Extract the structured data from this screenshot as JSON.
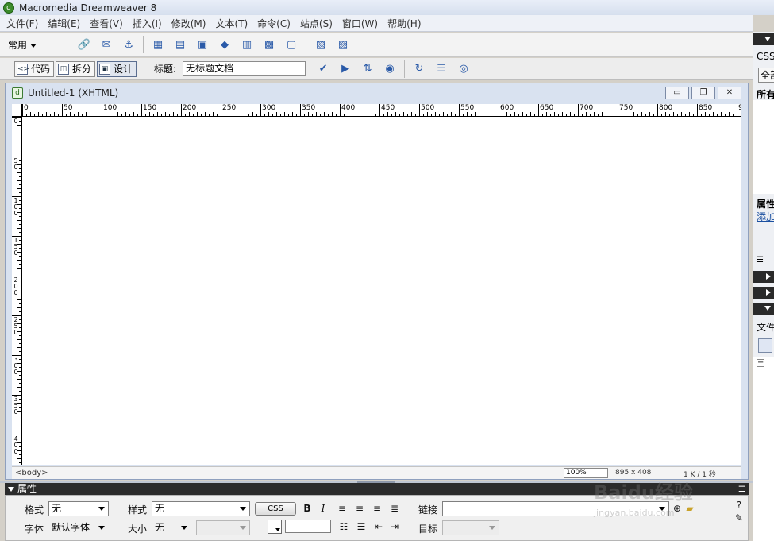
{
  "titlebar": {
    "title": "Macromedia Dreamweaver 8"
  },
  "menubar": {
    "items": [
      "文件(F)",
      "编辑(E)",
      "查看(V)",
      "插入(I)",
      "修改(M)",
      "文本(T)",
      "命令(C)",
      "站点(S)",
      "窗口(W)",
      "帮助(H)"
    ]
  },
  "insertbar": {
    "category": "常用",
    "icons": [
      "hyperlink-icon",
      "email-link-icon",
      "named-anchor-icon",
      "table-icon",
      "div-icon",
      "image-icon",
      "media-icon",
      "date-icon",
      "comment-icon",
      "head-icon",
      "template-icon",
      "tag-chooser-icon"
    ]
  },
  "doctoolbar": {
    "code_label": "代码",
    "split_label": "拆分",
    "design_label": "设计",
    "title_label": "标题:",
    "title_value": "无标题文档"
  },
  "document": {
    "tab_title": "Untitled-1 (XHTML)",
    "ruler_h": [
      "0",
      "50",
      "100",
      "150",
      "200",
      "250",
      "300",
      "350",
      "400",
      "450",
      "500",
      "550",
      "600",
      "650",
      "700",
      "750",
      "800",
      "850",
      "9"
    ],
    "ruler_v": [
      "0",
      "50",
      "100",
      "150",
      "200",
      "250",
      "300",
      "350",
      "400",
      "450"
    ],
    "status_tag": "<body>",
    "zoom": "100%",
    "dimensions": "895 x 408",
    "file_size": "1 K / 1 秒"
  },
  "properties": {
    "panel_title": "属性",
    "format_label": "格式",
    "format_value": "无",
    "style_label": "样式",
    "style_value": "无",
    "css_button": "CSS",
    "bold": "B",
    "italic": "I",
    "link_label": "链接",
    "font_label": "字体",
    "font_value": "默认字体",
    "size_label": "大小",
    "size_value": "无",
    "target_label": "目标"
  },
  "rightdock": {
    "css_label": "CSS",
    "all_button": "全部",
    "all_rules": "所有",
    "props_label": "属性",
    "add_link": "添加",
    "files_label": "文件"
  },
  "watermark": {
    "text": "Baidu经验",
    "sub": "jingyan.baidu.com"
  }
}
